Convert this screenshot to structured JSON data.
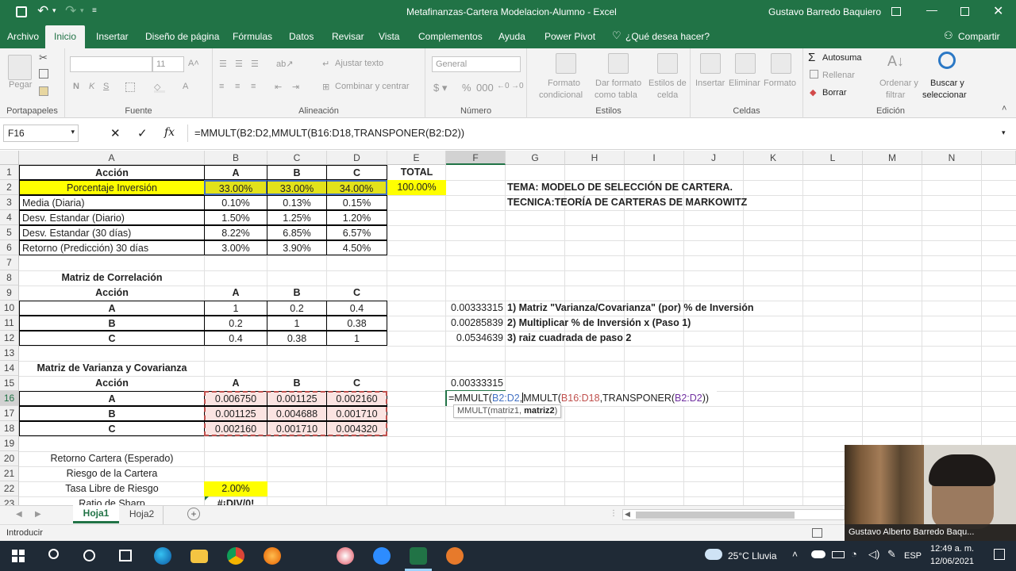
{
  "window": {
    "title": "Metafinanzas-Cartera Modelacion-Alumno  -  Excel",
    "user": "Gustavo  Barredo Baquiero"
  },
  "menu": {
    "tabs": [
      "Archivo",
      "Inicio",
      "Insertar",
      "Diseño de página",
      "Fórmulas",
      "Datos",
      "Revisar",
      "Vista",
      "Complementos",
      "Ayuda",
      "Power Pivot"
    ],
    "active": "Inicio",
    "tell_me": "¿Qué desea hacer?",
    "share": "Compartir"
  },
  "ribbon": {
    "portapapeles": {
      "label": "Portapapeles",
      "paste": "Pegar"
    },
    "fuente": {
      "label": "Fuente",
      "font_size": "11",
      "bold": "N",
      "italic": "K",
      "underline": "S"
    },
    "alineacion": {
      "label": "Alineación",
      "wrap": "Ajustar texto",
      "merge": "Combinar y centrar"
    },
    "numero": {
      "label": "Número",
      "format": "General"
    },
    "estilos": {
      "label": "Estilos",
      "cond1": "Formato",
      "cond2": "condicional",
      "tbl1": "Dar formato",
      "tbl2": "como tabla",
      "cs1": "Estilos de",
      "cs2": "celda"
    },
    "celdas": {
      "label": "Celdas",
      "insert": "Insertar",
      "delete": "Eliminar",
      "format": "Formato"
    },
    "edicion": {
      "label": "Edición",
      "autosum": "Autosuma",
      "fill": "Rellenar",
      "clear": "Borrar",
      "sort1": "Ordenar y",
      "sort2": "filtrar",
      "find1": "Buscar y",
      "find2": "seleccionar"
    }
  },
  "formula_bar": {
    "name_box": "F16",
    "formula": "=MMULT(B2:D2,MMULT(B16:D18,TRANSPONER(B2:D2))"
  },
  "columns": [
    "A",
    "B",
    "C",
    "D",
    "E",
    "F",
    "G",
    "H",
    "I",
    "J",
    "K",
    "L",
    "M",
    "N"
  ],
  "rows": [
    "1",
    "2",
    "3",
    "4",
    "5",
    "6",
    "7",
    "8",
    "9",
    "10",
    "11",
    "12",
    "13",
    "14",
    "15",
    "16",
    "17",
    "18",
    "19",
    "20",
    "21",
    "22",
    "23"
  ],
  "sheet": {
    "r1": {
      "a": "Acción",
      "b": "A",
      "c": "B",
      "d": "C",
      "e": "TOTAL"
    },
    "r2": {
      "a": "Porcentaje Inversión",
      "b": "33.00%",
      "c": "33.00%",
      "d": "34.00%",
      "e": "100.00%",
      "g": "TEMA: MODELO DE SELECCIÓN DE CARTERA."
    },
    "r3": {
      "a": "Media (Diaria)",
      "b": "0.10%",
      "c": "0.13%",
      "d": "0.15%",
      "g": "TECNICA:TEORÍA DE CARTERAS DE MARKOWITZ"
    },
    "r4": {
      "a": "Desv. Estandar (Diario)",
      "b": "1.50%",
      "c": "1.25%",
      "d": "1.20%"
    },
    "r5": {
      "a": "Desv. Estandar (30 días)",
      "b": "8.22%",
      "c": "6.85%",
      "d": "6.57%"
    },
    "r6": {
      "a": "Retorno (Predicción) 30 días",
      "b": "3.00%",
      "c": "3.90%",
      "d": "4.50%"
    },
    "r8": {
      "a": "Matriz de Correlación"
    },
    "r9": {
      "a": "Acción",
      "b": "A",
      "c": "B",
      "d": "C"
    },
    "r10": {
      "a": "A",
      "b": "1",
      "c": "0.2",
      "d": "0.4",
      "f": "0.00333315",
      "g": "1) Matriz \"Varianza/Covarianza\" (por) % de Inversión"
    },
    "r11": {
      "a": "B",
      "b": "0.2",
      "c": "1",
      "d": "0.38",
      "f": "0.00285839",
      "g": "2) Multiplicar % de Inversión x (Paso 1)"
    },
    "r12": {
      "a": "C",
      "b": "0.4",
      "c": "0.38",
      "d": "1",
      "f": "0.0534639",
      "g": "3) raiz cuadrada de paso 2"
    },
    "r14": {
      "a": "Matriz de Varianza y Covarianza"
    },
    "r15": {
      "a": "Acción",
      "b": "A",
      "c": "B",
      "d": "C",
      "f": "0.00333315"
    },
    "r16": {
      "a": "A",
      "b": "0.006750",
      "c": "0.001125",
      "d": "0.002160"
    },
    "r17": {
      "a": "B",
      "b": "0.001125",
      "c": "0.004688",
      "d": "0.001710"
    },
    "r18": {
      "a": "C",
      "b": "0.002160",
      "c": "0.001710",
      "d": "0.004320"
    },
    "r20": {
      "a": "Retorno Cartera (Esperado)"
    },
    "r21": {
      "a": "Riesgo de la Cartera"
    },
    "r22": {
      "a": "Tasa Libre de Riesgo",
      "b": "2.00%"
    },
    "r23": {
      "a": "Ratio de Sharp",
      "b": "#¡DIV/0!"
    }
  },
  "edit": {
    "p1": "=MMULT(",
    "p2": "B2:D2",
    "p3": ",",
    "p4": "MMULT(",
    "p5": "B16:D18",
    "p6": ",TRANSPONER(",
    "p7": "B2:D2",
    "p8": "))",
    "tooltip_fn": "MMULT(matriz1, ",
    "tooltip_arg": "matriz2",
    "tooltip_end": ")"
  },
  "sheet_tabs": [
    "Hoja1",
    "Hoja2"
  ],
  "status": {
    "mode": "Introducir",
    "webcam_name": "Gustavo Alberto Barredo Baqu..."
  },
  "taskbar": {
    "weather": "25°C  Lluvia",
    "lang": "ESP",
    "time": "12:49 a. m.",
    "date": "12/06/2021"
  },
  "colors": {
    "excel_green": "#217346",
    "highlight_yellow": "#ffff00",
    "ref_blue": "#4472c4",
    "ref_red": "#c0504d",
    "pink_fill": "#fbe4e2"
  }
}
